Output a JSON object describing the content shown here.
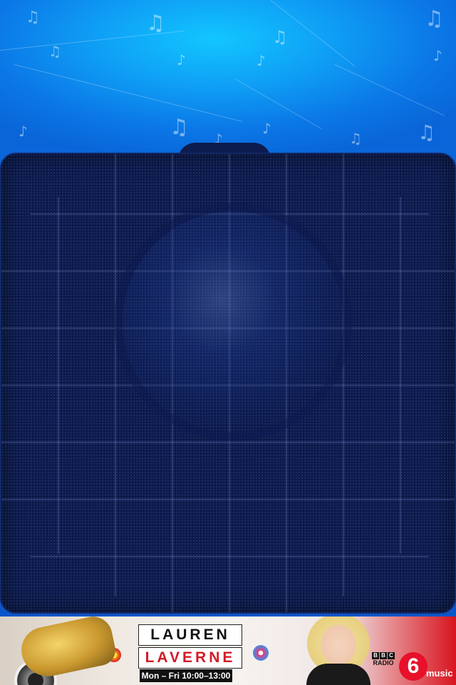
{
  "screen": {
    "header_icon": "music-note-icon",
    "accent_color": "#0f9ef5",
    "panel_color": "#0d1c4f"
  },
  "banner": {
    "presenter_first": "LAUREN",
    "presenter_last": "LAVERNE",
    "schedule": "Mon – Fri 10:00–13:00",
    "station_brand": "BBC",
    "station_label": "RADIO",
    "station_number": "6",
    "station_name": "music"
  }
}
